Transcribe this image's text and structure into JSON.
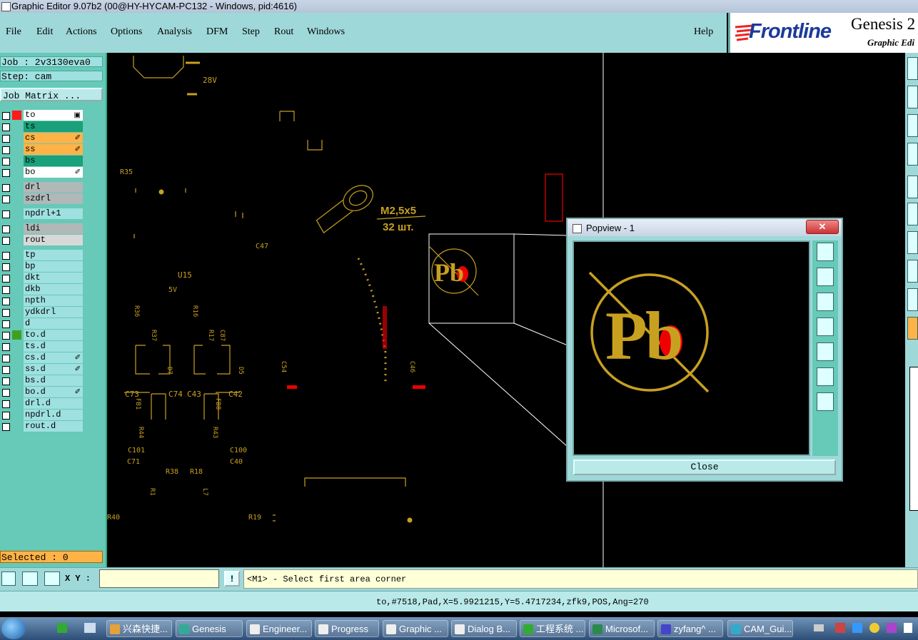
{
  "window": {
    "title": "Graphic Editor 9.07b2 (00@HY-HYCAM-PC132 - Windows, pid:4616)"
  },
  "menu": {
    "items": [
      {
        "label": "File"
      },
      {
        "label": "Edit"
      },
      {
        "label": "Actions"
      },
      {
        "label": "Options"
      },
      {
        "label": "Analysis"
      },
      {
        "label": "DFM"
      },
      {
        "label": "Step"
      },
      {
        "label": "Rout"
      },
      {
        "label": "Windows"
      }
    ],
    "help": "Help"
  },
  "logo": {
    "brand": "Frontline",
    "product": "Genesis 2",
    "subtitle": "Graphic Edi"
  },
  "left_panel": {
    "job": "Job : 2v3130eva0",
    "step": "Step: cam",
    "job_matrix": "Job Matrix ...",
    "selected": "Selected : 0",
    "layers": [
      {
        "name": "to",
        "bg": "#ffffff",
        "swatch": "#ff1a1a",
        "mark": "▣",
        "group": 0
      },
      {
        "name": "ts",
        "bg": "#1aa07a",
        "swatch": "",
        "mark": "",
        "group": 0
      },
      {
        "name": "cs",
        "bg": "#ffb347",
        "swatch": "",
        "mark": "✐",
        "group": 0
      },
      {
        "name": "ss",
        "bg": "#ffb347",
        "swatch": "",
        "mark": "✐",
        "group": 0
      },
      {
        "name": "bs",
        "bg": "#1aa07a",
        "swatch": "",
        "mark": "",
        "group": 0
      },
      {
        "name": "bo",
        "bg": "#ffffff",
        "swatch": "",
        "mark": "✐",
        "group": 0
      },
      {
        "name": "drl",
        "bg": "#b0b8b8",
        "swatch": "",
        "mark": "",
        "group": 1
      },
      {
        "name": "szdrl",
        "bg": "#b0b8b8",
        "swatch": "",
        "mark": "",
        "group": 1
      },
      {
        "name": "npdrl+1",
        "bg": "#9fe0e0",
        "swatch": "",
        "mark": "",
        "group": 2
      },
      {
        "name": "ldi",
        "bg": "#b0b8b8",
        "swatch": "",
        "mark": "",
        "group": 3
      },
      {
        "name": "rout",
        "bg": "#d8d8d8",
        "swatch": "",
        "mark": "",
        "group": 3
      },
      {
        "name": "tp",
        "bg": "#9fe0e0",
        "swatch": "",
        "mark": "",
        "group": 4
      },
      {
        "name": "bp",
        "bg": "#9fe0e0",
        "swatch": "",
        "mark": "",
        "group": 4
      },
      {
        "name": "dkt",
        "bg": "#9fe0e0",
        "swatch": "",
        "mark": "",
        "group": 4
      },
      {
        "name": "dkb",
        "bg": "#9fe0e0",
        "swatch": "",
        "mark": "",
        "group": 4
      },
      {
        "name": "npth",
        "bg": "#9fe0e0",
        "swatch": "",
        "mark": "",
        "group": 4
      },
      {
        "name": "ydkdrl",
        "bg": "#9fe0e0",
        "swatch": "",
        "mark": "",
        "group": 4
      },
      {
        "name": "d",
        "bg": "#9fe0e0",
        "swatch": "",
        "mark": "",
        "group": 4
      },
      {
        "name": "to.d",
        "bg": "#9fe0e0",
        "swatch": "#3fa020",
        "mark": "",
        "group": 4
      },
      {
        "name": "ts.d",
        "bg": "#9fe0e0",
        "swatch": "",
        "mark": "",
        "group": 4
      },
      {
        "name": "cs.d",
        "bg": "#9fe0e0",
        "swatch": "",
        "mark": "✐",
        "group": 4
      },
      {
        "name": "ss.d",
        "bg": "#9fe0e0",
        "swatch": "",
        "mark": "✐",
        "group": 4
      },
      {
        "name": "bs.d",
        "bg": "#9fe0e0",
        "swatch": "",
        "mark": "",
        "group": 4
      },
      {
        "name": "bo.d",
        "bg": "#9fe0e0",
        "swatch": "",
        "mark": "✐",
        "group": 4
      },
      {
        "name": "drl.d",
        "bg": "#9fe0e0",
        "swatch": "",
        "mark": "",
        "group": 4
      },
      {
        "name": "npdrl.d",
        "bg": "#9fe0e0",
        "swatch": "",
        "mark": "",
        "group": 4
      },
      {
        "name": "rout.d",
        "bg": "#9fe0e0",
        "swatch": "",
        "mark": "",
        "group": 4
      }
    ]
  },
  "canvas": {
    "labels": [
      "28V",
      "R35",
      "M2,5x5",
      "32 шт.",
      "C47",
      "U15",
      "5V",
      "R36",
      "R16",
      "R37",
      "R17",
      "C87",
      "C54",
      "C46",
      "C73",
      "C74",
      "C43",
      "C42",
      "FB1",
      "FB8",
      "R44",
      "R43",
      "C101",
      "C100",
      "C71",
      "C40",
      "R38",
      "R18",
      "R40",
      "R19",
      "Pb",
      "D7",
      "D5",
      "R1",
      "L7"
    ]
  },
  "popview": {
    "title": "Popview - 1",
    "close_label": "Close",
    "symbol_text": "Pb"
  },
  "command_bar": {
    "xy_label": "X Y :",
    "xy_value": "",
    "bang": "!",
    "prompt": "<M1> - Select first area corner"
  },
  "status": {
    "text": "to,#7518,Pad,X=5.9921215,Y=5.4717234,zfk9,POS,Ang=270"
  },
  "taskbar": {
    "tasks": [
      {
        "label": "兴森快捷..."
      },
      {
        "label": "Genesis"
      },
      {
        "label": "Engineer..."
      },
      {
        "label": "Progress"
      },
      {
        "label": "Graphic ..."
      },
      {
        "label": "Dialog B..."
      },
      {
        "label": "工程系统 ..."
      },
      {
        "label": "Microsof..."
      },
      {
        "label": "zyfang^ ..."
      },
      {
        "label": "CAM_Gui..."
      }
    ]
  },
  "colors": {
    "panel": "#9fd8d8",
    "layer_bg": "#67c9b8",
    "canvas": "#000000",
    "silk": "#c8a020",
    "highlight": "#ff1a1a"
  }
}
